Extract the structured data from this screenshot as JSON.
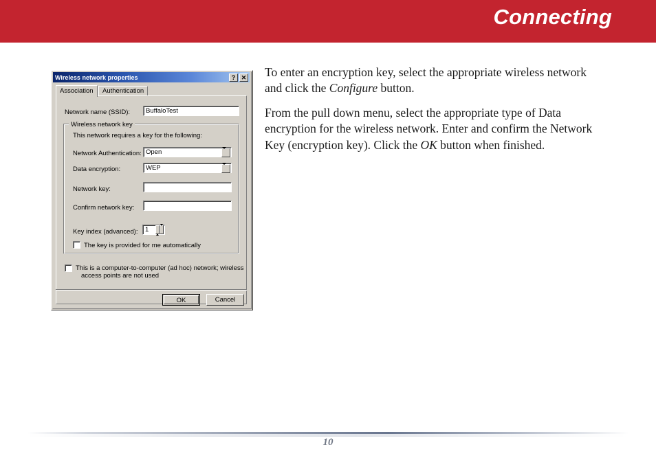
{
  "page": {
    "header_title": "Connecting",
    "header_color": "#c3242f",
    "page_number": "10"
  },
  "content": {
    "paragraphs": [
      {
        "segments": [
          {
            "text": "To enter an encryption key, select the appropriate wireless network and click the ",
            "italic": false
          },
          {
            "text": "Configure",
            "italic": true
          },
          {
            "text": " button.",
            "italic": false
          }
        ]
      },
      {
        "segments": [
          {
            "text": "From the pull down menu, select the appropriate type of  Data encryption for the wireless network.  Enter and confirm the Network Key (encryption key).  Click the ",
            "italic": false
          },
          {
            "text": "OK",
            "italic": true
          },
          {
            "text": " button when finished.",
            "italic": false
          }
        ]
      }
    ]
  },
  "dialog": {
    "title": "Wireless network properties",
    "help_button": "?",
    "close_button": "✕",
    "tabs": [
      {
        "label": "Association",
        "active": true
      },
      {
        "label": "Authentication",
        "active": false
      }
    ],
    "ssid": {
      "label": "Network name (SSID):",
      "value": "BuffaloTest",
      "placeholder": ""
    },
    "group": {
      "title": "Wireless network key",
      "intro": "This network requires a key for the following:",
      "network_auth": {
        "label": "Network Authentication:",
        "value": "Open"
      },
      "data_encryption": {
        "label": "Data encryption:",
        "value": "WEP"
      },
      "network_key": {
        "label": "Network key:",
        "value": ""
      },
      "confirm_key": {
        "label": "Confirm network key:",
        "value": ""
      },
      "key_index": {
        "label": "Key index (advanced):",
        "value": "1"
      },
      "auto_key": {
        "label": "The key is provided for me automatically",
        "checked": false
      }
    },
    "adhoc": {
      "line1": "This is a computer-to-computer (ad hoc) network; wireless",
      "line2": "access points are not used",
      "checked": false
    },
    "buttons": {
      "ok": "OK",
      "cancel": "Cancel"
    }
  }
}
